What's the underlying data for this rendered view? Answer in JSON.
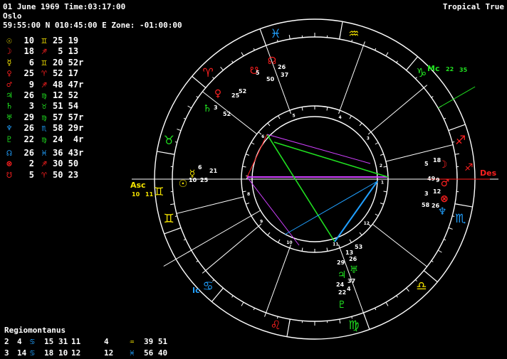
{
  "header": {
    "date_line": "01 June 1969 Time:03:17:00",
    "place": "Oslo",
    "coords_line": "59:55:00 N 010:45:00 E Zone: -01:00:00",
    "mode": "Tropical True"
  },
  "planets": [
    {
      "name": "sun-icon",
      "glyph": "☉",
      "color": "#f5e400",
      "deg": "10",
      "sign": "♊",
      "sign_color": "#f5e400",
      "min": "25 19"
    },
    {
      "name": "moon-icon",
      "glyph": "☽",
      "color": "#ff2020",
      "deg": "18",
      "sign": "♐",
      "sign_color": "#ff2020",
      "min": " 5 13"
    },
    {
      "name": "mercury-icon",
      "glyph": "☿",
      "color": "#f5e400",
      "deg": "6",
      "sign": "♊",
      "sign_color": "#f5e400",
      "min": "20 52r"
    },
    {
      "name": "venus-icon",
      "glyph": "♀",
      "color": "#ff2020",
      "deg": "25",
      "sign": "♈",
      "sign_color": "#ff2020",
      "min": "52 17"
    },
    {
      "name": "mars-icon",
      "glyph": "♂",
      "color": "#ff2020",
      "deg": "9",
      "sign": "♐",
      "sign_color": "#ff2020",
      "min": "48 47r"
    },
    {
      "name": "jupiter-icon",
      "glyph": "♃",
      "color": "#20e020",
      "deg": "26",
      "sign": "♍",
      "sign_color": "#20e020",
      "min": "12 52"
    },
    {
      "name": "saturn-icon",
      "glyph": "♄",
      "color": "#20e020",
      "deg": "3",
      "sign": "♉",
      "sign_color": "#20e020",
      "min": "51 54"
    },
    {
      "name": "uranus-icon",
      "glyph": "♅",
      "color": "#20e020",
      "deg": "29",
      "sign": "♍",
      "sign_color": "#20e020",
      "min": "57 57r"
    },
    {
      "name": "neptune-icon",
      "glyph": "♆",
      "color": "#20a0ff",
      "deg": "26",
      "sign": "♏",
      "sign_color": "#20a0ff",
      "min": "58 29r"
    },
    {
      "name": "pluto-icon",
      "glyph": "♇",
      "color": "#20e020",
      "deg": "22",
      "sign": "♍",
      "sign_color": "#20e020",
      "min": "24  4r"
    },
    {
      "name": "north-node-icon",
      "glyph": "☊",
      "color": "#20a0ff",
      "deg": "26",
      "sign": "♓",
      "sign_color": "#20a0ff",
      "min": "36 43r",
      "gap": true
    },
    {
      "name": "part-of-fortune-icon",
      "glyph": "⊗",
      "color": "#ff2020",
      "deg": "2",
      "sign": "♐",
      "sign_color": "#ff2020",
      "min": "30 50"
    },
    {
      "name": "south-node-icon",
      "glyph": "☋",
      "color": "#ff2020",
      "deg": "5",
      "sign": "♈",
      "sign_color": "#ff2020",
      "min": "50 23"
    }
  ],
  "houses": {
    "title": "Regiomontanus",
    "rows": [
      [
        {
          "num": "2",
          "deg": "4",
          "sign": "♋",
          "color": "#20a0ff",
          "min": "15"
        },
        {
          "num": "31",
          "deg": "11",
          "sign": "",
          "color": "#fff",
          "min": ""
        },
        {
          "num": "4",
          "deg": "",
          "sign": "♒",
          "color": "#f5e400",
          "min": "39 51"
        }
      ],
      [
        {
          "num": "3",
          "deg": "14",
          "sign": "♋",
          "color": "#20a0ff",
          "min": "18"
        },
        {
          "num": "10",
          "deg": "12",
          "sign": "",
          "color": "#fff",
          "min": ""
        },
        {
          "num": "12",
          "deg": "",
          "sign": "♓",
          "color": "#20a0ff",
          "min": "56 40"
        }
      ]
    ]
  },
  "wheel": {
    "zodiac_signs": [
      {
        "glyph": "♓",
        "color": "#20a0ff"
      },
      {
        "glyph": "♒",
        "color": "#f5e400"
      },
      {
        "glyph": "♑",
        "color": "#20e020"
      },
      {
        "glyph": "♐",
        "color": "#ff2020"
      },
      {
        "glyph": "♏",
        "color": "#20a0ff"
      },
      {
        "glyph": "♎",
        "color": "#f5e400"
      },
      {
        "glyph": "♍",
        "color": "#20e020"
      },
      {
        "glyph": "♌",
        "color": "#ff2020"
      },
      {
        "glyph": "♋",
        "color": "#20a0ff"
      },
      {
        "glyph": "♊",
        "color": "#f5e400"
      },
      {
        "glyph": "♉",
        "color": "#20e020"
      },
      {
        "glyph": "♈",
        "color": "#ff2020"
      }
    ],
    "asc_label": "Asc",
    "asc_deg": "10",
    "asc_min": "11",
    "des_label": "Des",
    "mc_label": "Mc",
    "mc_deg": "22",
    "mc_min": "35",
    "ic_label": "Ic",
    "house_numbers": [
      "1",
      "2",
      "3",
      "4",
      "5",
      "6",
      "7",
      "8",
      "9",
      "10",
      "11",
      "12"
    ],
    "planet_labels": [
      {
        "glyph": "☿",
        "color": "#f5e400",
        "deg": "6",
        "min": "21"
      },
      {
        "glyph": "☉",
        "color": "#f5e400",
        "deg": "10",
        "min": "25"
      },
      {
        "glyph": "☽",
        "color": "#ff2020",
        "deg": "5",
        "min": "18"
      },
      {
        "glyph": "♂",
        "color": "#ff2020",
        "deg": "49",
        "min": "9"
      },
      {
        "glyph": "⊗",
        "color": "#ff2020",
        "deg": "3",
        "min": "12"
      },
      {
        "glyph": "♆",
        "color": "#20a0ff",
        "deg": "58",
        "min": "26"
      },
      {
        "glyph": "♅",
        "color": "#20e020",
        "deg": "13",
        "min": "53"
      },
      {
        "glyph": "♃",
        "color": "#20e020",
        "deg": "29",
        "min": "26"
      },
      {
        "glyph": "♇",
        "color": "#20e020",
        "deg": "24",
        "min": "37"
      },
      {
        "glyph": "☋",
        "color": "#ff2020",
        "deg": "5",
        "min": "50"
      },
      {
        "glyph": "♀",
        "color": "#ff2020",
        "deg": "25",
        "min": "52"
      },
      {
        "glyph": "♄",
        "color": "#20e020",
        "deg": "3",
        "min": "52"
      },
      {
        "glyph": "☊",
        "color": "#ff2020",
        "deg": "26",
        "min": "37"
      },
      {
        "extra": "22",
        "extra2": "4"
      }
    ]
  }
}
